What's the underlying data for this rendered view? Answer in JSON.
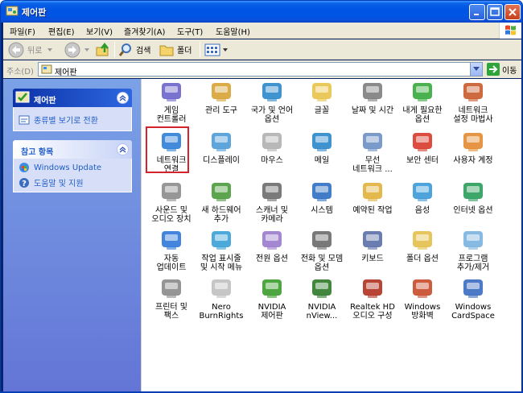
{
  "window": {
    "title": "제어판"
  },
  "menubar": {
    "items": [
      "파일(F)",
      "편집(E)",
      "보기(V)",
      "즐겨찾기(A)",
      "도구(T)",
      "도움말(H)"
    ]
  },
  "toolbar": {
    "back_label": "뒤로",
    "search_label": "검색",
    "folder_label": "폴더"
  },
  "address": {
    "label": "주소(D)",
    "value": "제어판",
    "go_label": "이동"
  },
  "sidebar": {
    "control_panel": {
      "title": "제어판",
      "link": "종류별 보기로 전환"
    },
    "see_also": {
      "title": "참고 항목",
      "links": [
        "Windows Update",
        "도움말 및 지원"
      ]
    }
  },
  "items": [
    {
      "label": "게임\n컨트롤러",
      "icon": "game-controller-icon"
    },
    {
      "label": "관리 도구",
      "icon": "admin-tools-icon"
    },
    {
      "label": "국가 및 언어\n옵션",
      "icon": "globe-icon"
    },
    {
      "label": "글꼴",
      "icon": "fonts-folder-icon"
    },
    {
      "label": "날짜 및 시간",
      "icon": "clock-icon"
    },
    {
      "label": "내게 필요한\n옵션",
      "icon": "accessibility-icon"
    },
    {
      "label": "네트워크\n설정 마법사",
      "icon": "house-network-icon"
    },
    {
      "label": "네트워크\n연결",
      "icon": "network-connection-icon"
    },
    {
      "label": "디스플레이",
      "icon": "display-icon"
    },
    {
      "label": "마우스",
      "icon": "mouse-icon"
    },
    {
      "label": "메일",
      "icon": "mail-icon"
    },
    {
      "label": "무선\n네트워크 ...",
      "icon": "wireless-icon"
    },
    {
      "label": "보안 센터",
      "icon": "shield-icon"
    },
    {
      "label": "사용자 계정",
      "icon": "users-icon"
    },
    {
      "label": "사운드 및\n오디오 장치",
      "icon": "speaker-icon"
    },
    {
      "label": "새 하드웨어\n추가",
      "icon": "hardware-icon"
    },
    {
      "label": "스캐너 및\n카메라",
      "icon": "scanner-icon"
    },
    {
      "label": "시스템",
      "icon": "system-icon"
    },
    {
      "label": "예약된 작업",
      "icon": "scheduled-tasks-icon"
    },
    {
      "label": "음성",
      "icon": "speech-icon"
    },
    {
      "label": "인터넷 옵션",
      "icon": "internet-options-icon"
    },
    {
      "label": "자동\n업데이트",
      "icon": "windows-update-icon"
    },
    {
      "label": "작업 표시줄\n및 시작 메뉴",
      "icon": "taskbar-icon"
    },
    {
      "label": "전원 옵션",
      "icon": "power-icon"
    },
    {
      "label": "전화 및 모뎀\n옵션",
      "icon": "phone-modem-icon"
    },
    {
      "label": "키보드",
      "icon": "keyboard-icon"
    },
    {
      "label": "폴더 옵션",
      "icon": "folder-options-icon"
    },
    {
      "label": "프로그램\n추가/제거",
      "icon": "add-remove-programs-icon"
    },
    {
      "label": "프린터 및\n팩스",
      "icon": "printer-icon"
    },
    {
      "label": "Nero\nBurnRights",
      "icon": "nero-icon"
    },
    {
      "label": "NVIDIA\n제어판",
      "icon": "nvidia-icon"
    },
    {
      "label": "NVIDIA\nnView...",
      "icon": "nvidia-nview-icon"
    },
    {
      "label": "Realtek HD\n오디오 구성",
      "icon": "realtek-audio-icon"
    },
    {
      "label": "Windows\n방화벽",
      "icon": "firewall-icon"
    },
    {
      "label": "Windows\nCardSpace",
      "icon": "cardspace-icon"
    }
  ]
}
